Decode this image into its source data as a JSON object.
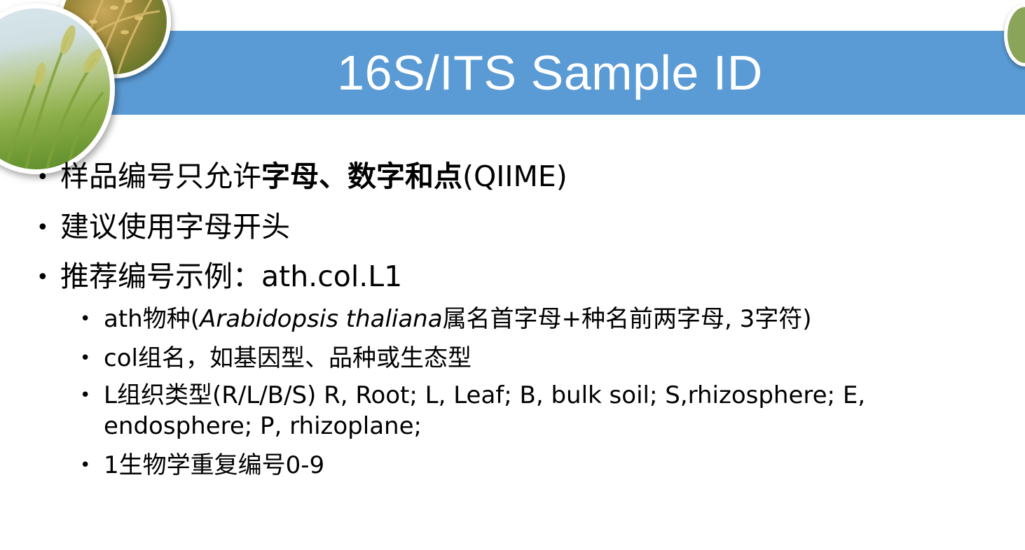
{
  "slide": {
    "title": "16S/ITS Sample ID",
    "colors": {
      "banner": "#5b9bd5",
      "title_text": "#ffffff",
      "body_text": "#000000"
    },
    "bullets": [
      {
        "prefix": "样品编号只允许",
        "bold": "字母、数字和点",
        "suffix": "(QIIME)"
      },
      {
        "text": "建议使用字母开头"
      },
      {
        "text": "推荐编号示例：ath.col.L1"
      }
    ],
    "sub_bullets": [
      {
        "prefix": "ath物种(",
        "italic": "Arabidopsis thaliana",
        "suffix": "属名首字母+种名前两字母, 3字符)"
      },
      {
        "text": "col组名，如基因型、品种或生态型"
      },
      {
        "text": "L组织类型(R/L/B/S) R, Root; L, Leaf; B, bulk soil; S,rhizosphere; E, endosphere; P, rhizoplane;"
      },
      {
        "text": "1生物学重复编号0-9"
      }
    ],
    "decor": {
      "photo_left_large": "wheat-field-photo",
      "photo_left_small": "rice-ear-photo",
      "photo_right": "field-photo"
    }
  }
}
